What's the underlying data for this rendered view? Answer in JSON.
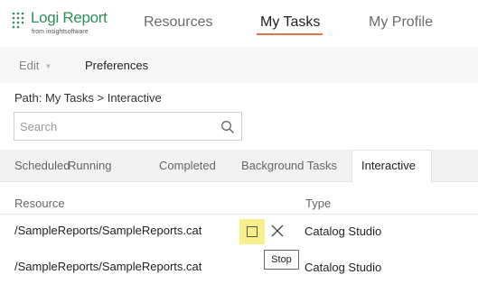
{
  "header": {
    "logo_text": "Logi Report",
    "logo_subtext": "from insightsoftware",
    "nav": [
      {
        "label": "Resources"
      },
      {
        "label": "My Tasks"
      },
      {
        "label": "My Profile"
      }
    ],
    "accent_color": "#e8734a",
    "brand_color": "#2e8f5a"
  },
  "toolbar": {
    "edit_label": "Edit",
    "preferences_label": "Preferences"
  },
  "path": "Path: My Tasks > Interactive",
  "search": {
    "placeholder": "Search",
    "value": ""
  },
  "tabs": [
    {
      "label": "Scheduled"
    },
    {
      "label": "Running"
    },
    {
      "label": "Completed"
    },
    {
      "label": "Background Tasks"
    },
    {
      "label": "Interactive"
    }
  ],
  "active_tab": "Interactive",
  "table": {
    "columns": [
      "Resource",
      "Type"
    ],
    "rows": [
      {
        "resource": "/SampleReports/SampleReports.cat",
        "type": "Catalog Studio"
      },
      {
        "resource": "/SampleReports/SampleReports.cat",
        "type": "Catalog Studio"
      }
    ]
  },
  "row_actions": {
    "stop_icon": "stop-square-icon",
    "close_icon": "close-icon",
    "highlight_color": "#f8ef8a"
  },
  "tooltip": "Stop"
}
